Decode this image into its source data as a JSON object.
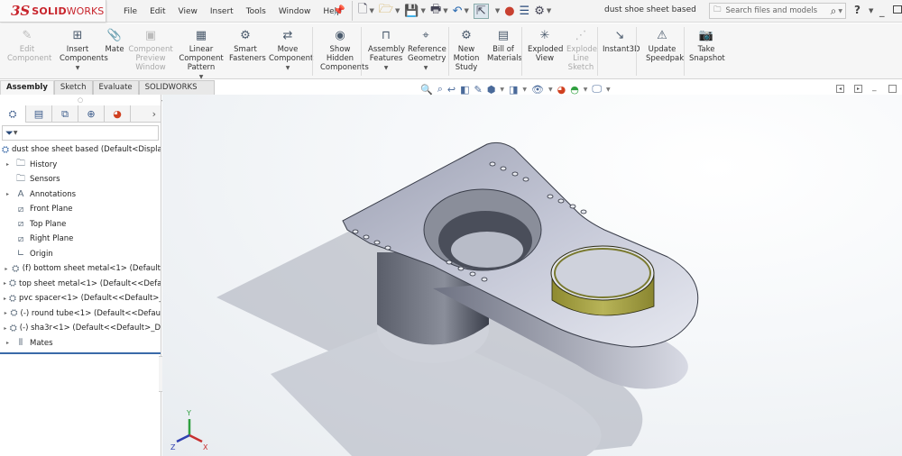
{
  "app": {
    "logo_ds": "3S",
    "logo_solid": "SOLID",
    "logo_works": "WORKS",
    "document_title": "dust shoe sheet based"
  },
  "menu": [
    "File",
    "Edit",
    "View",
    "Insert",
    "Tools",
    "Window",
    "Help"
  ],
  "quick_access": {
    "icons": [
      "new-document-icon",
      "open-icon",
      "save-icon",
      "print-icon",
      "undo-icon",
      "select-icon",
      "rebuild-traffic-light-icon",
      "file-properties-icon",
      "options-gear-icon"
    ]
  },
  "search": {
    "placeholder": "Search files and models"
  },
  "help_label": "?",
  "ribbon": [
    {
      "label": [
        "Edit",
        "Component"
      ],
      "icon": "edit-component-icon",
      "disabled": true,
      "dropdown": false
    },
    {
      "label": [
        "Insert",
        "Components"
      ],
      "icon": "insert-components-icon",
      "disabled": false,
      "dropdown": true
    },
    {
      "label": [
        "Mate"
      ],
      "icon": "mate-paperclip-icon",
      "disabled": false,
      "dropdown": false
    },
    {
      "label": [
        "Component",
        "Preview",
        "Window"
      ],
      "icon": "component-preview-icon",
      "disabled": true,
      "dropdown": false
    },
    {
      "label": [
        "Linear",
        "Component",
        "Pattern"
      ],
      "icon": "linear-pattern-icon",
      "disabled": false,
      "dropdown": true
    },
    {
      "label": [
        "Smart",
        "Fasteners"
      ],
      "icon": "smart-fasteners-icon",
      "disabled": false,
      "dropdown": false
    },
    {
      "label": [
        "Move",
        "Component"
      ],
      "icon": "move-component-icon",
      "disabled": false,
      "dropdown": true
    },
    {
      "label": [
        "Show",
        "Hidden",
        "Components"
      ],
      "icon": "show-hidden-icon",
      "disabled": false,
      "dropdown": false
    },
    {
      "label": [
        "Assembly",
        "Features"
      ],
      "icon": "assembly-features-icon",
      "disabled": false,
      "dropdown": true
    },
    {
      "label": [
        "Reference",
        "Geometry"
      ],
      "icon": "reference-geometry-icon",
      "disabled": false,
      "dropdown": true
    },
    {
      "label": [
        "New",
        "Motion",
        "Study"
      ],
      "icon": "motion-study-icon",
      "disabled": false,
      "dropdown": false
    },
    {
      "label": [
        "Bill of",
        "Materials"
      ],
      "icon": "bill-of-materials-icon",
      "disabled": false,
      "dropdown": false
    },
    {
      "label": [
        "Exploded",
        "View"
      ],
      "icon": "exploded-view-icon",
      "disabled": false,
      "dropdown": false
    },
    {
      "label": [
        "Explode",
        "Line",
        "Sketch"
      ],
      "icon": "explode-line-sketch-icon",
      "disabled": true,
      "dropdown": false
    },
    {
      "label": [
        "Instant3D"
      ],
      "icon": "instant3d-icon",
      "disabled": false,
      "dropdown": false
    },
    {
      "label": [
        "Update",
        "Speedpak"
      ],
      "icon": "speedpak-icon",
      "disabled": false,
      "dropdown": false
    },
    {
      "label": [
        "Take",
        "Snapshot"
      ],
      "icon": "camera-icon",
      "disabled": false,
      "dropdown": false
    }
  ],
  "command_tabs": [
    {
      "label": "Assembly",
      "active": true
    },
    {
      "label": "Sketch",
      "active": false
    },
    {
      "label": "Evaluate",
      "active": false
    },
    {
      "label": "SOLIDWORKS Add-Ins",
      "active": false
    }
  ],
  "feature_tree": {
    "root": "dust shoe sheet based  (Default<Display",
    "items": [
      {
        "label": "History",
        "expandable": true,
        "icon": "history-folder-icon"
      },
      {
        "label": "Sensors",
        "expandable": false,
        "icon": "sensors-folder-icon"
      },
      {
        "label": "Annotations",
        "expandable": true,
        "icon": "annotations-icon"
      },
      {
        "label": "Front Plane",
        "expandable": false,
        "icon": "plane-icon"
      },
      {
        "label": "Top Plane",
        "expandable": false,
        "icon": "plane-icon"
      },
      {
        "label": "Right Plane",
        "expandable": false,
        "icon": "plane-icon"
      },
      {
        "label": "Origin",
        "expandable": false,
        "icon": "origin-icon"
      },
      {
        "label": "(f) bottom sheet metal<1> (Default",
        "expandable": true,
        "icon": "part-icon"
      },
      {
        "label": "top sheet metal<1> (Default<<Defa",
        "expandable": true,
        "icon": "part-icon"
      },
      {
        "label": "pvc spacer<1> (Default<<Default>_",
        "expandable": true,
        "icon": "part-icon"
      },
      {
        "label": "(-) round tube<1> (Default<<Defau",
        "expandable": true,
        "icon": "part-icon"
      },
      {
        "label": "(-) sha3r<1> (Default<<Default>_D",
        "expandable": true,
        "icon": "part-icon"
      },
      {
        "label": "Mates",
        "expandable": true,
        "icon": "mates-icon"
      }
    ]
  },
  "triad": {
    "x": "X",
    "y": "Y",
    "z": "Z"
  },
  "colors": {
    "brand_red": "#c8242c",
    "tube_olive": "#a8a040",
    "triad_x": "#c83030",
    "triad_y": "#30a040",
    "triad_z": "#3040b0"
  }
}
